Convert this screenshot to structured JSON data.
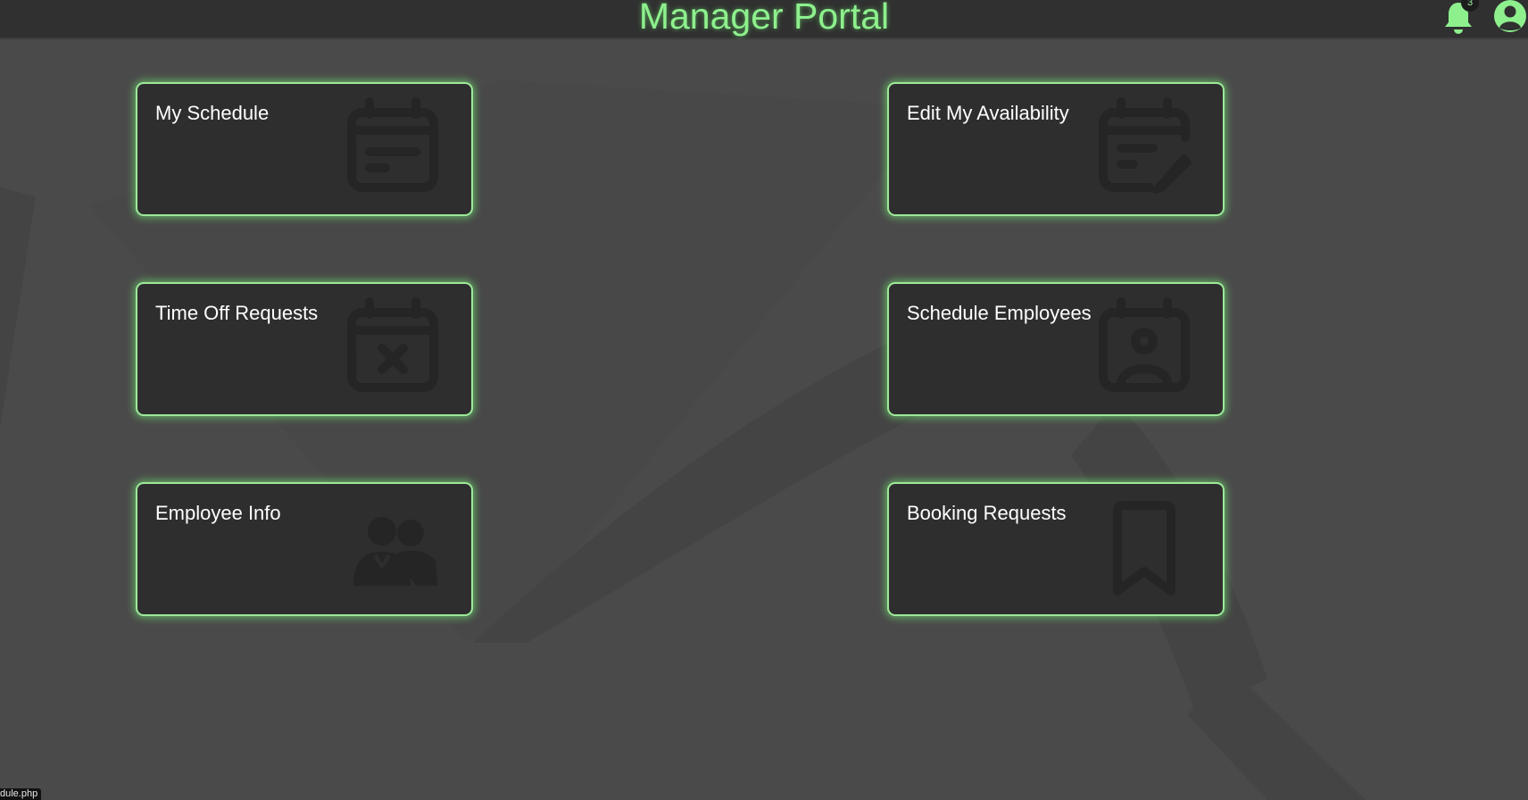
{
  "header": {
    "title": "Manager Portal",
    "notification_count": "3",
    "notifications_icon": "bell-icon",
    "account_icon": "user-circle-icon"
  },
  "cards": [
    {
      "label": "My Schedule",
      "icon": "calendar-icon"
    },
    {
      "label": "Edit My Availability",
      "icon": "calendar-edit-icon"
    },
    {
      "label": "Time Off Requests",
      "icon": "calendar-x-icon"
    },
    {
      "label": "Schedule Employees",
      "icon": "calendar-user-icon"
    },
    {
      "label": "Employee Info",
      "icon": "users-icon"
    },
    {
      "label": "Booking Requests",
      "icon": "bookmark-icon"
    }
  ],
  "status_bar": {
    "url_text": "dule.php"
  },
  "colors": {
    "accent": "#8df08d",
    "card_background": "#2e2e2e",
    "page_background": "#4a4a4a",
    "header_background": "#303030"
  }
}
